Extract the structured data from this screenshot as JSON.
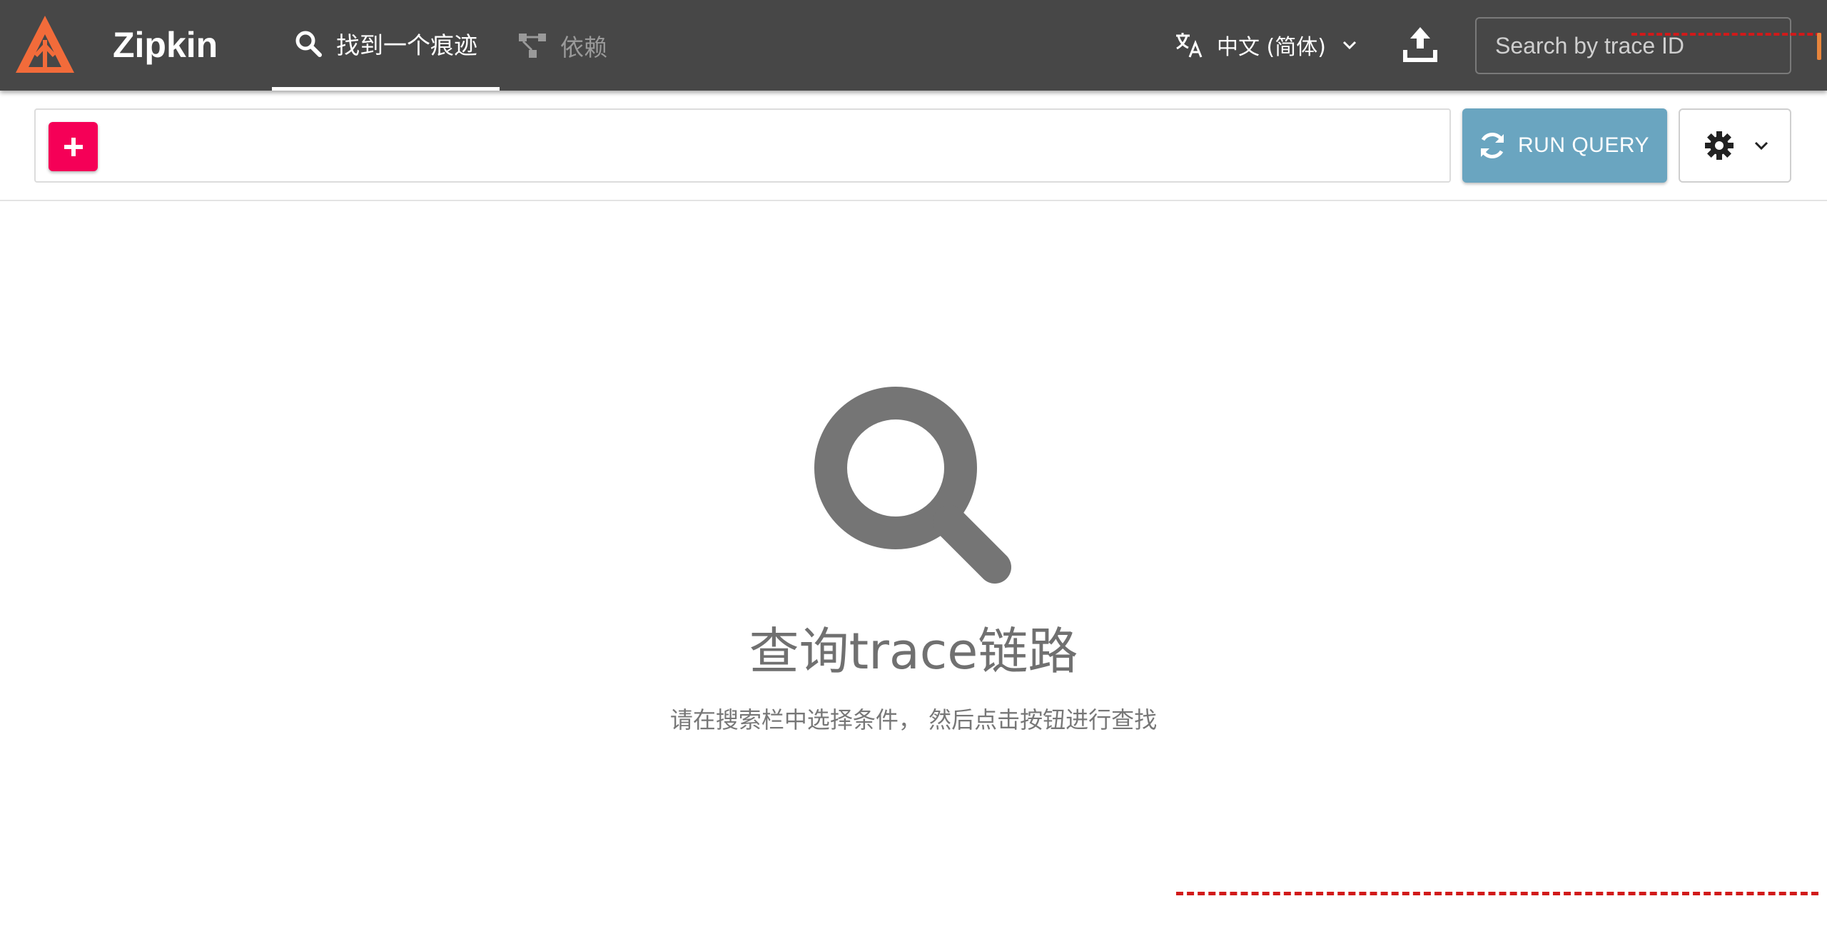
{
  "appbar": {
    "brand": "Zipkin",
    "colors": {
      "background": "#474747",
      "logo": "#f26b3a",
      "active_tab_underline": "#ffffff"
    },
    "logo_icon": "zipkin-logo",
    "tabs": [
      {
        "label": "找到一个痕迹",
        "icon": "search-icon",
        "active": true
      },
      {
        "label": "依赖",
        "icon": "dependency-tree-icon",
        "active": false
      }
    ],
    "language": {
      "icon": "translate-icon",
      "label": "中文 (简体)",
      "dropdown_icon": "chevron-down-icon"
    },
    "upload_icon": "upload-icon",
    "trace_search": {
      "placeholder": "Search by trace ID",
      "value": ""
    }
  },
  "toolbar": {
    "add_button_icon": "plus-icon",
    "add_button_color": "#f50057",
    "run_query": {
      "label": "RUN QUERY",
      "icon": "refresh-icon",
      "color": "#6aa5c0"
    },
    "settings": {
      "icon": "gear-icon",
      "dropdown_icon": "chevron-down-icon"
    }
  },
  "empty_state": {
    "icon": "magnifier-icon",
    "title": "查询trace链路",
    "subtitle": "请在搜索栏中选择条件， 然后点击按钮进行查找"
  }
}
